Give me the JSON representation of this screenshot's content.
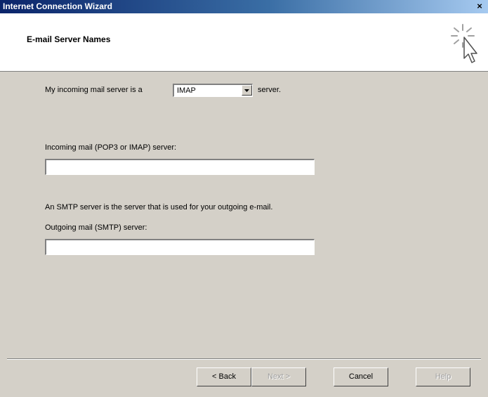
{
  "window": {
    "title": "Internet Connection Wizard",
    "close_label": "×"
  },
  "header": {
    "title": "E-mail Server Names",
    "icon": "wizard-cursor-icon"
  },
  "form": {
    "incoming_type_prefix": "My incoming mail server is a",
    "incoming_type_value": "IMAP",
    "incoming_type_suffix": "server.",
    "incoming_server_label": "Incoming mail (POP3 or IMAP) server:",
    "incoming_server_value": "",
    "smtp_description": "An SMTP server is the server that is used for your outgoing e-mail.",
    "outgoing_server_label": "Outgoing mail (SMTP) server:",
    "outgoing_server_value": ""
  },
  "buttons": {
    "back": "< Back",
    "next": "Next >",
    "cancel": "Cancel",
    "help": "Help"
  }
}
